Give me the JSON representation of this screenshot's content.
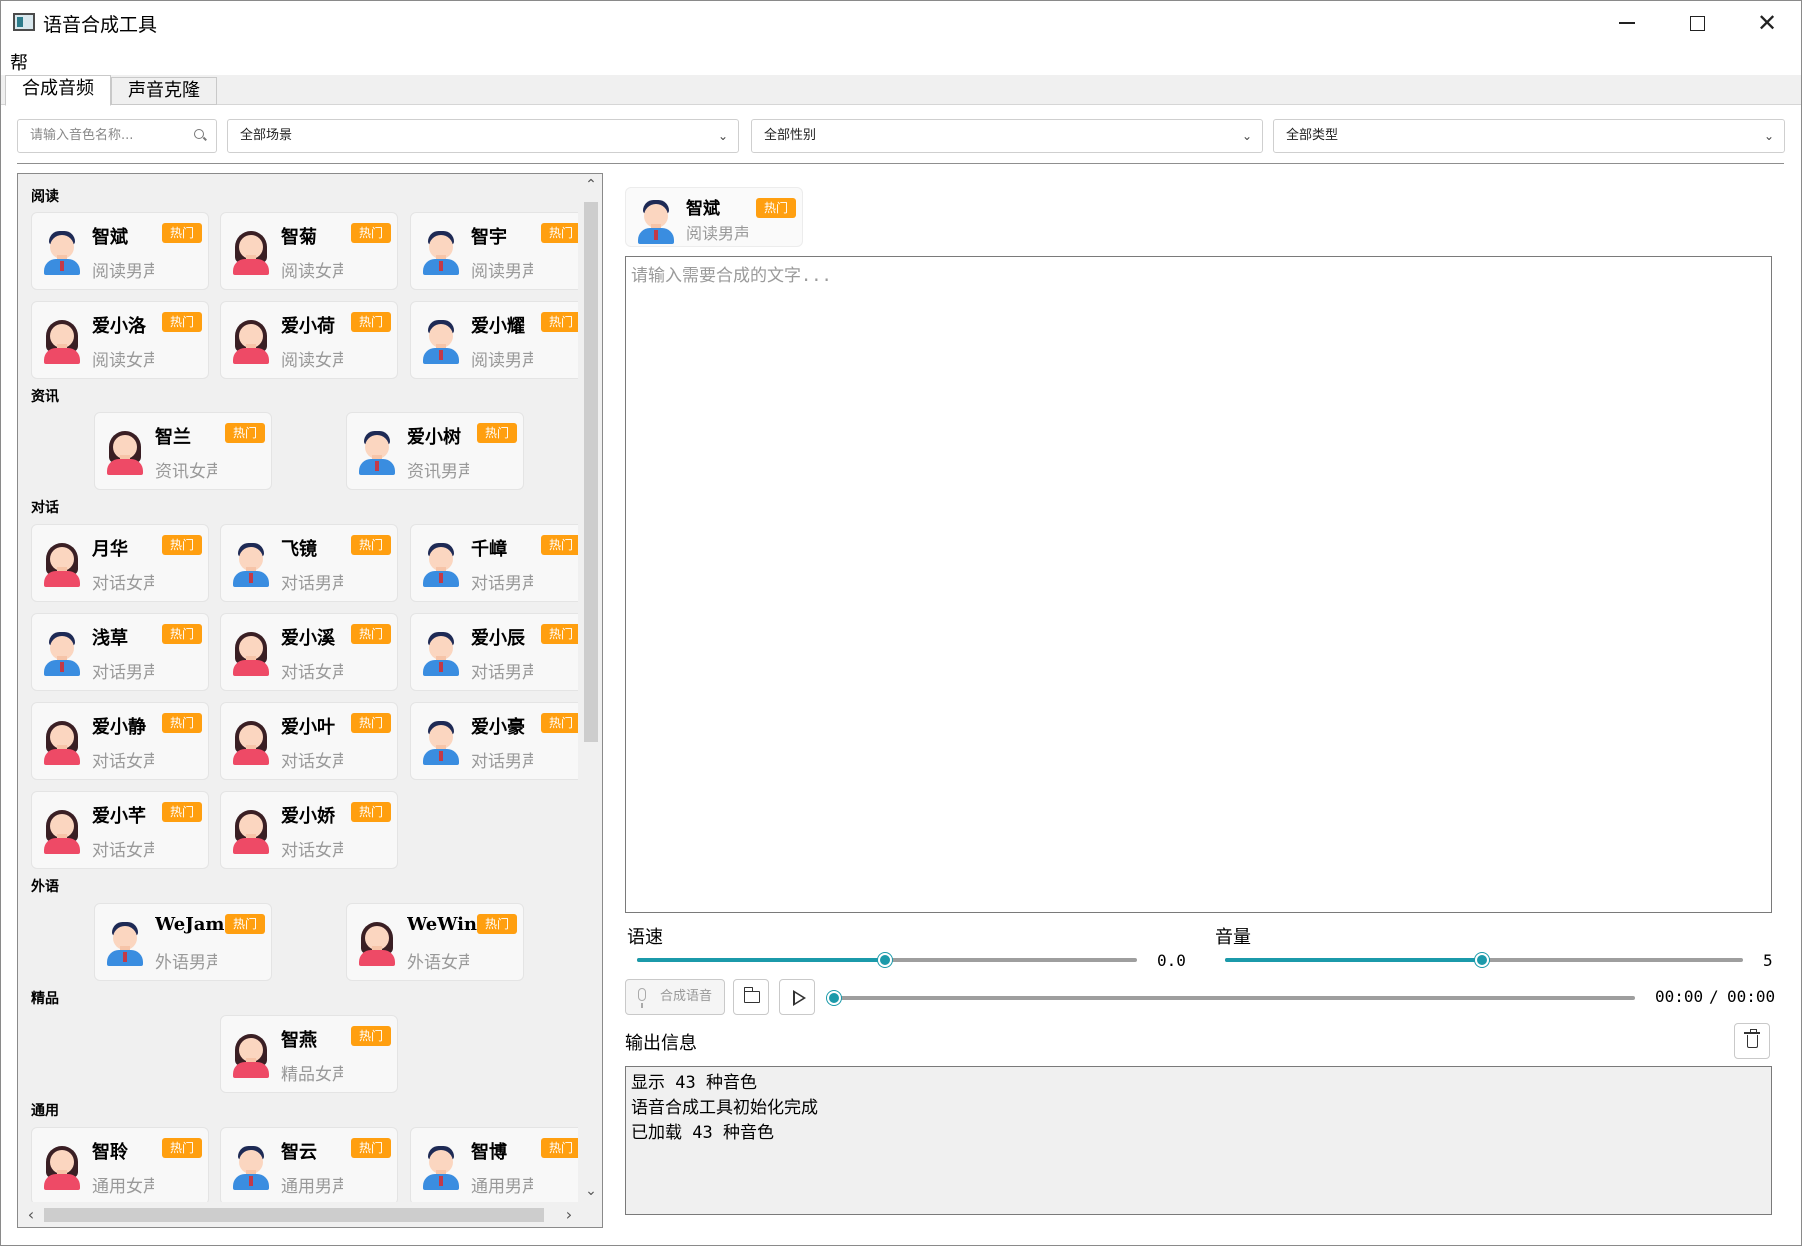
{
  "window": {
    "title": "语音合成工具"
  },
  "menu": {
    "help": "帮助"
  },
  "tabs": [
    {
      "label": "合成音频"
    },
    {
      "label": "声音克隆"
    }
  ],
  "filters": {
    "search_placeholder": "请输入音色名称...",
    "scene": "全部场景",
    "gender": "全部性别",
    "type": "全部类型"
  },
  "hot_label": "热门",
  "categories": {
    "reading": {
      "label": "阅读",
      "cards": [
        {
          "name": "智斌",
          "desc": "阅读男声",
          "gender": "male"
        },
        {
          "name": "智菊",
          "desc": "阅读女声",
          "gender": "female"
        },
        {
          "name": "智宇",
          "desc": "阅读男声",
          "gender": "male"
        },
        {
          "name": "爱小洛",
          "desc": "阅读女声",
          "gender": "female"
        },
        {
          "name": "爱小荷",
          "desc": "阅读女声",
          "gender": "female"
        },
        {
          "name": "爱小耀",
          "desc": "阅读男声",
          "gender": "male"
        }
      ]
    },
    "news": {
      "label": "资讯",
      "cards": [
        {
          "name": "智兰",
          "desc": "资讯女声",
          "gender": "female"
        },
        {
          "name": "爱小树",
          "desc": "资讯男声",
          "gender": "male"
        }
      ]
    },
    "dialog": {
      "label": "对话",
      "cards": [
        {
          "name": "月华",
          "desc": "对话女声",
          "gender": "female"
        },
        {
          "name": "飞镜",
          "desc": "对话男声",
          "gender": "male"
        },
        {
          "name": "千嶂",
          "desc": "对话男声",
          "gender": "male"
        },
        {
          "name": "浅草",
          "desc": "对话男声",
          "gender": "male"
        },
        {
          "name": "爱小溪",
          "desc": "对话女声",
          "gender": "female"
        },
        {
          "name": "爱小辰",
          "desc": "对话男声",
          "gender": "male"
        },
        {
          "name": "爱小静",
          "desc": "对话女声",
          "gender": "female"
        },
        {
          "name": "爱小叶",
          "desc": "对话女声",
          "gender": "female"
        },
        {
          "name": "爱小豪",
          "desc": "对话男声",
          "gender": "male"
        },
        {
          "name": "爱小芊",
          "desc": "对话女声",
          "gender": "female"
        },
        {
          "name": "爱小娇",
          "desc": "对话女声",
          "gender": "female"
        }
      ]
    },
    "foreign": {
      "label": "外语",
      "cards": [
        {
          "name": "WeJames",
          "desc": "外语男声",
          "gender": "male"
        },
        {
          "name": "WeWinny",
          "desc": "外语女声",
          "gender": "female"
        }
      ]
    },
    "premium": {
      "label": "精品",
      "cards": [
        {
          "name": "智燕",
          "desc": "精品女声",
          "gender": "female"
        }
      ]
    },
    "general": {
      "label": "通用",
      "cards": [
        {
          "name": "智聆",
          "desc": "通用女声",
          "gender": "female"
        },
        {
          "name": "智云",
          "desc": "通用男声",
          "gender": "male"
        },
        {
          "name": "智博",
          "desc": "通用男声",
          "gender": "male"
        }
      ]
    }
  },
  "selected_voice": {
    "name": "智斌",
    "desc": "阅读男声",
    "gender": "male"
  },
  "text_input": {
    "placeholder": "请输入需要合成的文字...",
    "value": ""
  },
  "speed": {
    "label": "语速",
    "value": "0.0",
    "fraction": 0.5
  },
  "volume": {
    "label": "音量",
    "value": "5",
    "fraction": 0.5
  },
  "synth_button": "合成语音",
  "playback": {
    "current": "00:00",
    "separator": "/",
    "total": "00:00",
    "fraction": 0
  },
  "output": {
    "label": "输出信息",
    "lines": [
      "显示 43 种音色",
      "语音合成工具初始化完成",
      "已加载 43 种音色"
    ]
  },
  "colors": {
    "accent": "#1b9aaa",
    "hot_badge": "#ff9f10",
    "male_shirt": "#3a8de0",
    "female_shirt": "#ee4a66"
  }
}
